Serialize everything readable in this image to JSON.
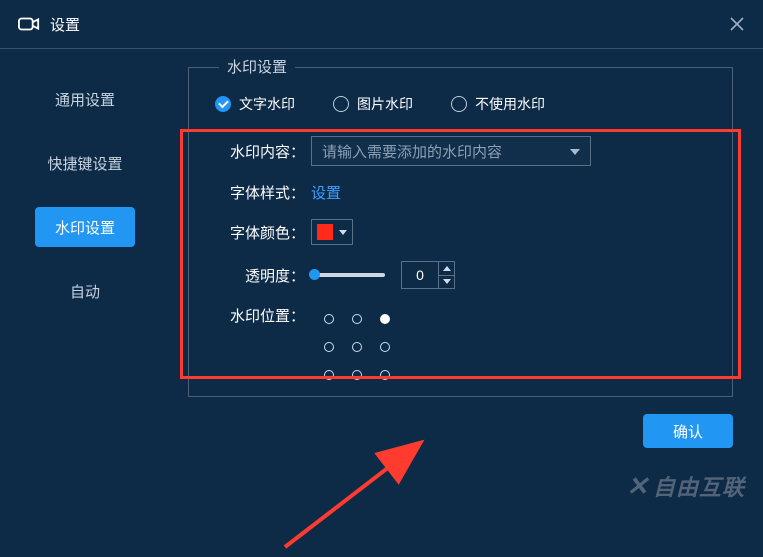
{
  "header": {
    "title": "设置"
  },
  "sidebar": {
    "items": [
      {
        "label": "通用设置"
      },
      {
        "label": "快捷键设置"
      },
      {
        "label": "水印设置"
      },
      {
        "label": "自动"
      }
    ]
  },
  "panel": {
    "legend": "水印设置",
    "watermark_type": {
      "text": "文字水印",
      "image": "图片水印",
      "none": "不使用水印"
    },
    "content": {
      "label": "水印内容：",
      "placeholder": "请输入需要添加的水印内容"
    },
    "font_style": {
      "label": "字体样式：",
      "link": "设置"
    },
    "font_color": {
      "label": "字体颜色：",
      "value": "#ff2a1a"
    },
    "opacity": {
      "label": "透明度：",
      "value": "0"
    },
    "position": {
      "label": "水印位置："
    }
  },
  "footer": {
    "confirm": "确认"
  },
  "brand": {
    "text": "自由互联"
  }
}
